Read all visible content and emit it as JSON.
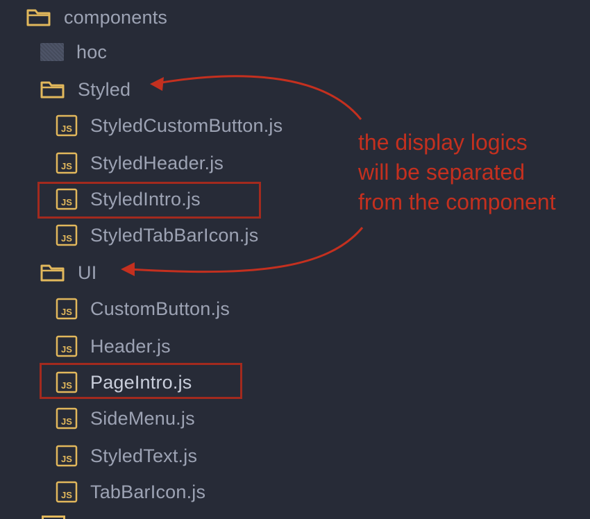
{
  "tree": {
    "root_folder": {
      "label": "components",
      "icon": "folder-open-icon"
    },
    "hoc_folder": {
      "label": "hoc",
      "icon": "folder-closed-icon"
    },
    "styled_folder": {
      "label": "Styled",
      "icon": "folder-open-icon",
      "files": [
        {
          "label": "StyledCustomButton.js",
          "icon": "js-file-icon"
        },
        {
          "label": "StyledHeader.js",
          "icon": "js-file-icon"
        },
        {
          "label": "StyledIntro.js",
          "icon": "js-file-icon",
          "highlighted": true
        },
        {
          "label": "StyledTabBarIcon.js",
          "icon": "js-file-icon"
        }
      ]
    },
    "ui_folder": {
      "label": "UI",
      "icon": "folder-open-icon",
      "files": [
        {
          "label": "CustomButton.js",
          "icon": "js-file-icon"
        },
        {
          "label": "Header.js",
          "icon": "js-file-icon"
        },
        {
          "label": "PageIntro.js",
          "icon": "js-file-icon",
          "highlighted": true
        },
        {
          "label": "SideMenu.js",
          "icon": "js-file-icon"
        },
        {
          "label": "StyledText.js",
          "icon": "js-file-icon"
        },
        {
          "label": "TabBarIcon.js",
          "icon": "js-file-icon"
        }
      ]
    }
  },
  "annotation": {
    "lines": [
      "the display logics",
      "will be separated",
      "from the component"
    ]
  },
  "colors": {
    "background": "#272b37",
    "text": "#9da3b4",
    "folder": "#e2b85c",
    "js_icon": "#e2b85c",
    "annotation": "#c4301f",
    "highlight_box": "#a32a1e"
  }
}
